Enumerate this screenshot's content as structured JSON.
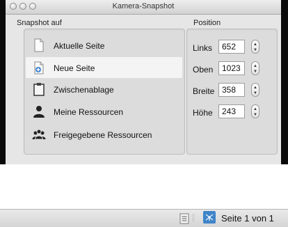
{
  "window": {
    "title": "Kamera-Snapshot"
  },
  "snapshot": {
    "label": "Snapshot auf",
    "items": [
      {
        "label": "Aktuelle Seite",
        "icon": "page-icon",
        "selected": false
      },
      {
        "label": "Neue Seite",
        "icon": "new-page-icon",
        "selected": true
      },
      {
        "label": "Zwischenablage",
        "icon": "clipboard-icon",
        "selected": false
      },
      {
        "label": "Meine Ressourcen",
        "icon": "person-icon",
        "selected": false
      },
      {
        "label": "Freigegebene Ressourcen",
        "icon": "people-icon",
        "selected": false
      }
    ]
  },
  "position": {
    "label": "Position",
    "fields": [
      {
        "label": "Links",
        "value": "652"
      },
      {
        "label": "Oben",
        "value": "1023"
      },
      {
        "label": "Breite",
        "value": "358"
      },
      {
        "label": "Höhe",
        "value": "243"
      }
    ]
  },
  "statusbar": {
    "page_text": "Seite 1 von 1"
  }
}
